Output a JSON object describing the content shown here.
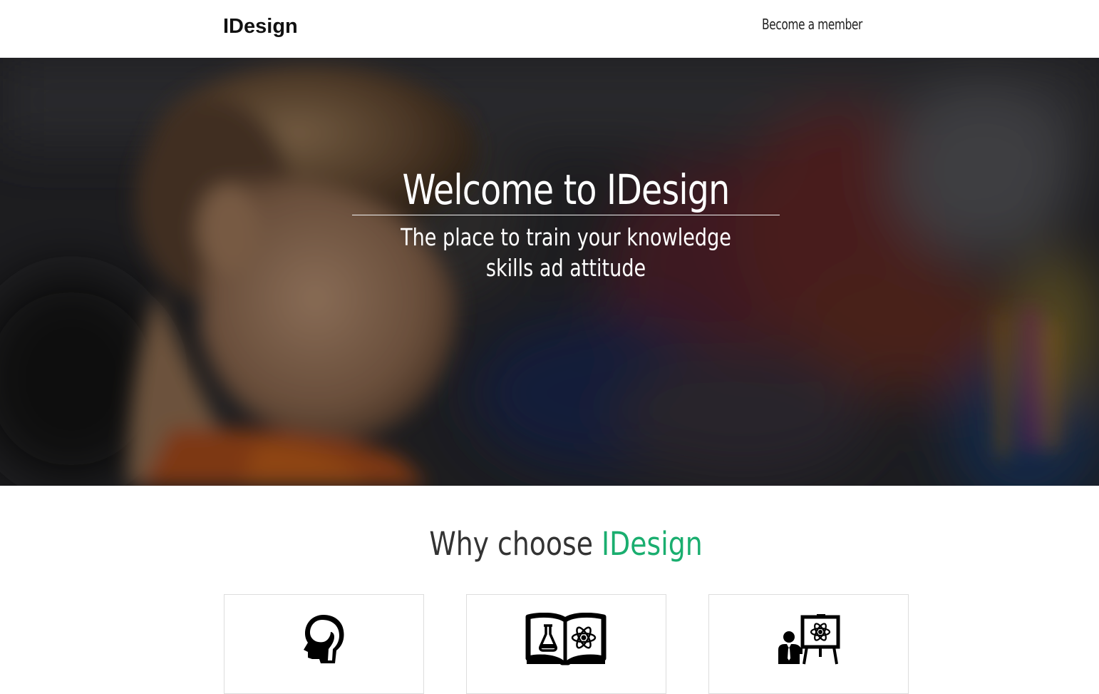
{
  "header": {
    "logo": "IDesign",
    "member_link": "Become a member"
  },
  "hero": {
    "title": "Welcome to IDesign",
    "subtitle_line1": "The place to train your knowledge",
    "subtitle_line2": "skills ad attitude"
  },
  "why": {
    "title_prefix": "Why choose ",
    "title_brand": "IDesign"
  },
  "features": [
    {
      "icon": "head-brain-icon"
    },
    {
      "icon": "science-book-icon"
    },
    {
      "icon": "teacher-presentation-icon"
    }
  ],
  "colors": {
    "accent": "#1aae6f",
    "text": "#333333"
  }
}
